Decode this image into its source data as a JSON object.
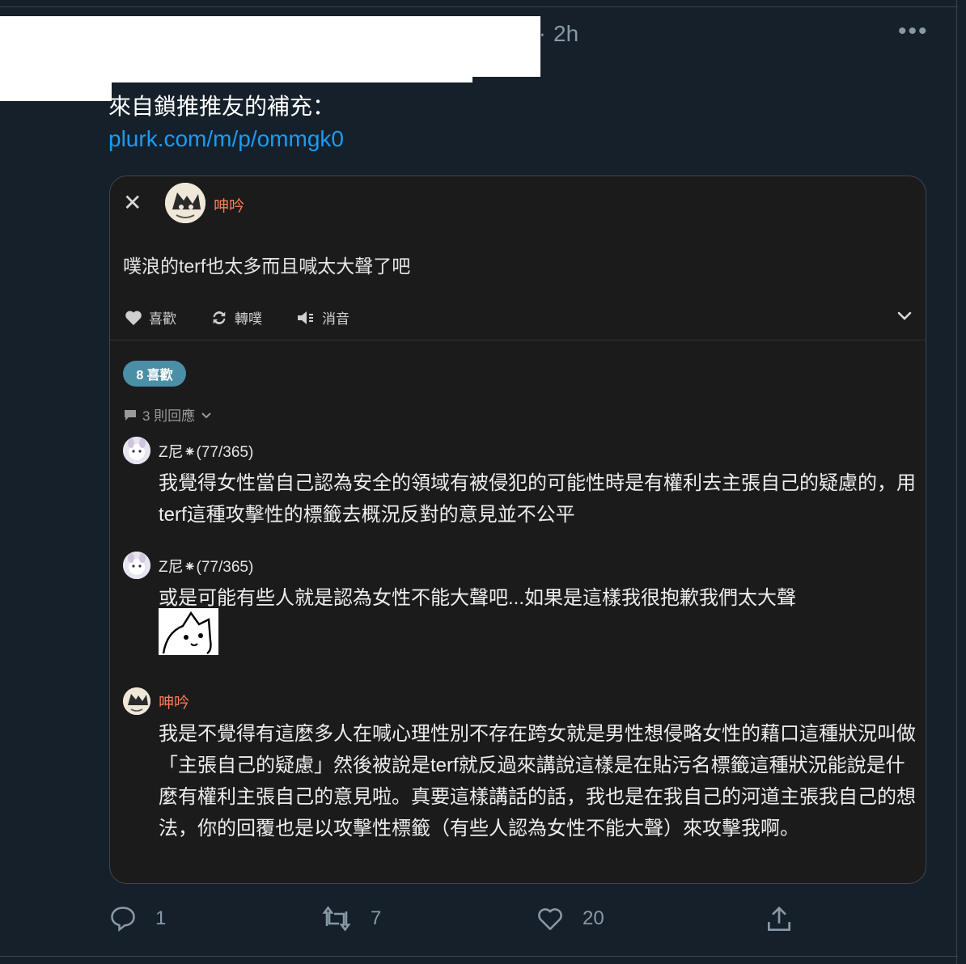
{
  "tweet": {
    "timestamp": "2h",
    "separator": "·",
    "more_label": "•••",
    "text": "來自鎖推推友的補充：",
    "link": "plurk.com/m/p/ommgk0"
  },
  "plurk": {
    "author": "呻吟",
    "text": "噗浪的terf也太多而且喊太大聲了吧",
    "actions": {
      "like": "喜歡",
      "replurk": "轉噗",
      "mute": "消音"
    },
    "likes_badge": "8 喜歡",
    "replies_count": "3 則回應",
    "replies": [
      {
        "name": "Z尼⁕(77/365)",
        "text": "我覺得女性當自己認為安全的領域有被侵犯的可能性時是有權利去主張自己的疑慮的，用terf這種攻擊性的標籤去概況反對的意見並不公平"
      },
      {
        "name": "Z尼⁕(77/365)",
        "text": "或是可能有些人就是認為女性不能大聲吧...如果是這樣我很抱歉我們太大聲"
      },
      {
        "name": "呻吟",
        "text": "我是不覺得有這麼多人在喊心理性別不存在跨女就是男性想侵略女性的藉口這種狀況叫做「主張自己的疑慮」然後被說是terf就反過來講說這樣是在貼污名標籤這種狀況能說是什麼有權利主張自己的意見啦。真要這樣講話的話，我也是在我自己的河道主張我自己的想法，你的回覆也是以攻擊性標籤（有些人認為女性不能大聲）來攻擊我啊。"
      }
    ]
  },
  "tweet_actions": {
    "replies": "1",
    "retweets": "7",
    "likes": "20"
  },
  "colors": {
    "background": "#15202b",
    "link": "#1d9bf0",
    "plurk_author": "#ff7a5a",
    "pill": "#4a8fa6"
  }
}
